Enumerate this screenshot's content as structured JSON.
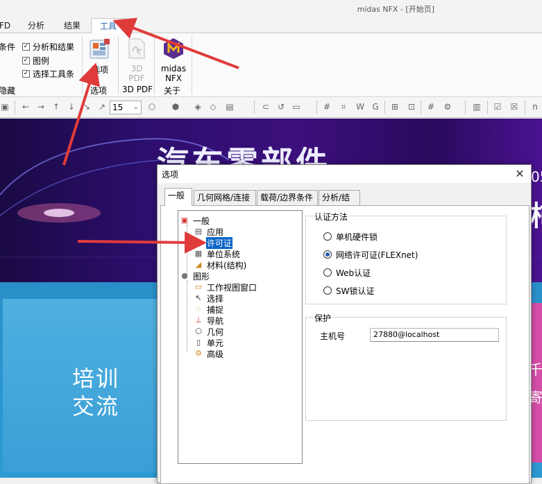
{
  "window": {
    "title": "midas NFX - [开始页]"
  },
  "ribbon": {
    "tabs": [
      {
        "label": "FD"
      },
      {
        "label": "分析"
      },
      {
        "label": "结果"
      },
      {
        "label": "工具",
        "active": true
      }
    ],
    "checks": [
      {
        "prefix": "条件",
        "label": "分析和结果",
        "checked": true
      },
      {
        "label": "图例",
        "checked": true
      },
      {
        "label": "选择工具条",
        "checked": true
      }
    ],
    "hide_group_label": "隐藏",
    "options_button": {
      "label": "选项",
      "group": "选项"
    },
    "pdf_button": {
      "line1": "3D",
      "line2": "PDF",
      "group": "3D PDF"
    },
    "nfx_button": {
      "line1": "midas",
      "line2": "NFX",
      "group": "关于"
    }
  },
  "toolbar": {
    "zoom_value": "15"
  },
  "background": {
    "headline": "汽车零部件",
    "card_text_line1": "培训",
    "card_text_line2": "交流",
    "right_fragment_1": "05",
    "right_fragment_2": "柿",
    "right_fragment_3": "千",
    "right_fragment_4": "寄"
  },
  "dialog": {
    "title": "选项",
    "close_icon": "close-icon",
    "tabs": [
      {
        "label": "一般",
        "active": true
      },
      {
        "label": "几何网格/连接"
      },
      {
        "label": "载荷/边界条件"
      },
      {
        "label": "分析/结果"
      }
    ],
    "tree": [
      {
        "label": "一般",
        "level": 0,
        "icon": "general-folder-icon"
      },
      {
        "label": "应用",
        "level": 1,
        "icon": "application-icon"
      },
      {
        "label": "许可证",
        "level": 1,
        "icon": "lock-icon",
        "selected": true
      },
      {
        "label": "单位系统",
        "level": 1,
        "icon": "unit-system-icon"
      },
      {
        "label": "材料(结构)",
        "level": 1,
        "icon": "material-icon"
      },
      {
        "label": "图形",
        "level": 0,
        "icon": "sphere-icon"
      },
      {
        "label": "工作视图窗口",
        "level": 1,
        "icon": "view-window-icon"
      },
      {
        "label": "选择",
        "level": 1,
        "icon": "cursor-icon"
      },
      {
        "label": "捕捉",
        "level": 1,
        "icon": "snap-icon"
      },
      {
        "label": "导航",
        "level": 1,
        "icon": "navigation-icon"
      },
      {
        "label": "几何",
        "level": 1,
        "icon": "geometry-cube-icon"
      },
      {
        "label": "单元",
        "level": 1,
        "icon": "element-icon"
      },
      {
        "label": "高级",
        "level": 1,
        "icon": "advanced-icon"
      }
    ],
    "auth_group": {
      "title": "认证方法",
      "options": [
        {
          "label": "单机硬件锁",
          "selected": false
        },
        {
          "label": "网络许可证(FLEXnet)",
          "selected": true
        },
        {
          "label": "Web认证",
          "selected": false
        },
        {
          "label": "SW锁认证",
          "selected": false
        }
      ]
    },
    "protect_group": {
      "title": "保护",
      "host_label": "主机号",
      "host_value": "27880@localhost"
    }
  },
  "colors": {
    "annotation_arrow": "#e03b3b",
    "selection": "#0a64c8",
    "banner": "#2b0e6b"
  }
}
